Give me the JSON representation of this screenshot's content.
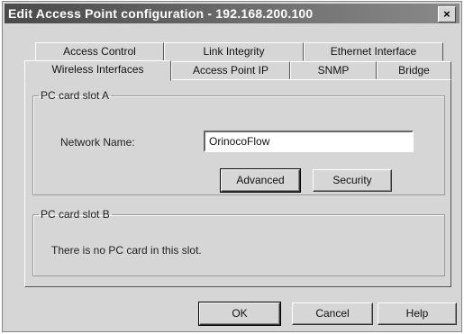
{
  "window": {
    "title": "Edit Access Point configuration - 192.168.200.100",
    "close_glyph": "×"
  },
  "tabs": {
    "row1": [
      "Access Control",
      "Link Integrity",
      "Ethernet Interface"
    ],
    "row2": [
      "Wireless Interfaces",
      "Access Point IP",
      "SNMP",
      "Bridge"
    ],
    "active": "Wireless Interfaces"
  },
  "slot_a": {
    "legend": "PC card slot A",
    "network_name_label": "Network Name:",
    "network_name_value": "OrinocoFlow",
    "advanced_label": "Advanced",
    "security_label": "Security"
  },
  "slot_b": {
    "legend": "PC card slot B",
    "message": "There is no PC card in this slot."
  },
  "footer": {
    "ok_label": "OK",
    "cancel_label": "Cancel",
    "help_label": "Help"
  }
}
